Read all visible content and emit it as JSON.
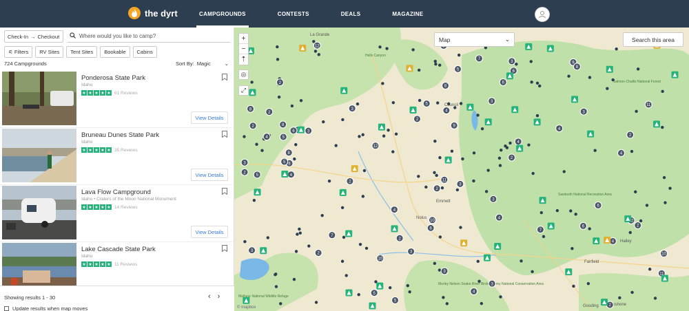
{
  "header": {
    "brand": "the dyrt",
    "nav": [
      "CAMPGROUNDS",
      "CONTESTS",
      "DEALS",
      "MAGAZINE"
    ]
  },
  "search": {
    "checkin": "Check-In",
    "checkout": "Checkout",
    "placeholder": "Where would you like to camp?"
  },
  "filters": [
    "Filters",
    "RV Sites",
    "Tent Sites",
    "Bookable",
    "Cabins"
  ],
  "results": {
    "count": "724 Campgrounds",
    "sort_label": "Sort By:",
    "sort_value": "Magic"
  },
  "cards": [
    {
      "title": "Ponderosa State Park",
      "sub": "Idaho",
      "reviews": "61 Reviews",
      "button": "View Details"
    },
    {
      "title": "Bruneau Dunes State Park",
      "sub": "Idaho",
      "reviews": "35 Reviews",
      "button": "View Details"
    },
    {
      "title": "Lava Flow Campground",
      "sub": "Idaho • Craters of the Moon National Monument",
      "reviews": "14 Reviews",
      "button": "View Details"
    },
    {
      "title": "Lake Cascade State Park",
      "sub": "Idaho",
      "reviews": "11 Reviews",
      "button": "View Details"
    }
  ],
  "footer": {
    "showing": "Showing results 1 - 30",
    "update": "Update results when map moves"
  },
  "map": {
    "select": "Map",
    "search_area": "Search this area",
    "labels": [
      "La Grande",
      "Council",
      "Emmett",
      "Nolus",
      "Hailey",
      "Fairfield",
      "Gooding",
      "Shoshone",
      "Malheur National Wildlife Refuge",
      "Morley Nelson Snake River Birds of Prey National Conservation Area",
      "Sawtooth National Recreation Area",
      "Salmon-Challis National Forest",
      "Hells Canyon"
    ],
    "attribution": "© mapbox",
    "colors": {
      "forest": "#bfe0a8",
      "water": "#7ab8e8",
      "pin_cluster": "#4a5566",
      "pin_green": "#25b37b",
      "pin_yellow": "#e0b030"
    }
  },
  "colors": {
    "header_bg": "#2c3e50",
    "accent": "#25b37b",
    "link": "#3a7bd5"
  }
}
